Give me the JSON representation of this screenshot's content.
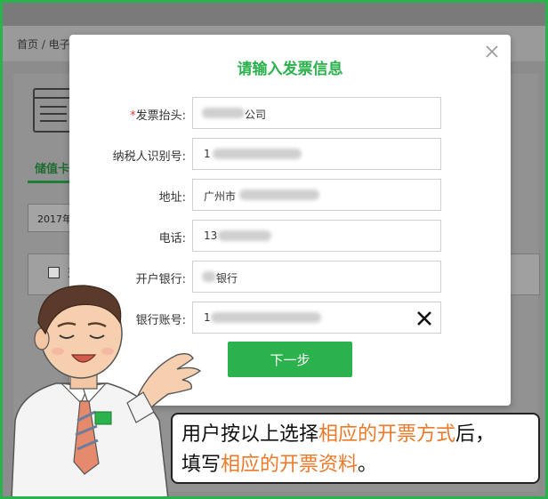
{
  "background": {
    "breadcrumb": "首页 / 电子",
    "tab_label": "储值卡",
    "select_value": "2017年",
    "row_label": "选"
  },
  "modal": {
    "title": "请输入发票信息",
    "fields": [
      {
        "label": "发票抬头:",
        "required_mark": "*",
        "value": "公司"
      },
      {
        "label": "纳税人识别号:",
        "value": "1"
      },
      {
        "label": "地址:",
        "value": "广州市"
      },
      {
        "label": "电话:",
        "value": "13"
      },
      {
        "label": "开户银行:",
        "value": "银行"
      },
      {
        "label": "银行账号:",
        "value": "1"
      }
    ],
    "next_button": "下一步"
  },
  "callout": {
    "line1_a": "用户按以上选择",
    "line1_hl": "相应的开票方式",
    "line1_b": "后，",
    "line2_a": "填写",
    "line2_hl": "相应的开票资料",
    "line2_b": "。"
  },
  "colors": {
    "accent": "#2bb24c",
    "highlight": "#ec7a2a",
    "required": "#e3373a"
  },
  "icons": [
    "close-icon",
    "clear-input-icon",
    "document-icon",
    "checkbox-icon"
  ]
}
